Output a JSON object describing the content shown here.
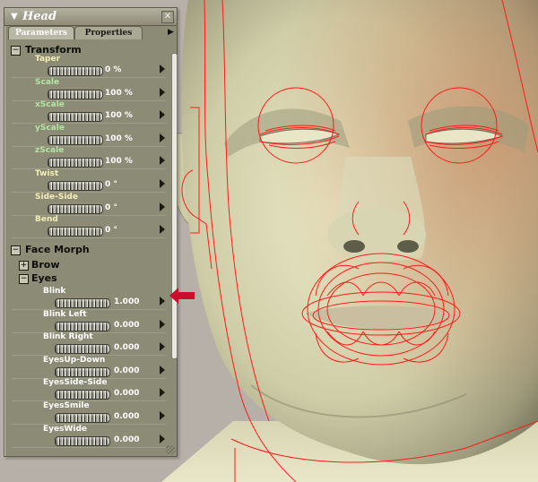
{
  "panel": {
    "title": "Head",
    "tabs": [
      {
        "label": "Parameters",
        "active": true
      },
      {
        "label": "Properties",
        "active": false
      }
    ],
    "groups": [
      {
        "label": "Transform",
        "expanded": true,
        "level": 0,
        "params": [
          {
            "label": "Taper",
            "value": "0 %",
            "color": "#f3efb4"
          },
          {
            "label": "Scale",
            "value": "100 %",
            "color": "#b3e6a3"
          },
          {
            "label": "xScale",
            "value": "100 %",
            "color": "#b3e6a3"
          },
          {
            "label": "yScale",
            "value": "100 %",
            "color": "#b3e6a3"
          },
          {
            "label": "zScale",
            "value": "100 %",
            "color": "#b3e6a3"
          },
          {
            "label": "Twist",
            "value": "0 °",
            "color": "#f3efb4"
          },
          {
            "label": "Side-Side",
            "value": "0 °",
            "color": "#f3efb4"
          },
          {
            "label": "Bend",
            "value": "0 °",
            "color": "#f3efb4"
          }
        ]
      },
      {
        "label": "Face Morph",
        "expanded": true,
        "level": 0,
        "params": []
      },
      {
        "label": "Brow",
        "expanded": false,
        "level": 1,
        "params": []
      },
      {
        "label": "Eyes",
        "expanded": true,
        "level": 1,
        "params": [
          {
            "label": "Blink",
            "value": "1.000",
            "color": "#ffffff"
          },
          {
            "label": "Blink Left",
            "value": "0.000",
            "color": "#ffffff"
          },
          {
            "label": "Blink Right",
            "value": "0.000",
            "color": "#ffffff"
          },
          {
            "label": "EyesUp-Down",
            "value": "0.000",
            "color": "#ffffff"
          },
          {
            "label": "EyesSide-Side",
            "value": "0.000",
            "color": "#ffffff"
          },
          {
            "label": "EyesSmile",
            "value": "0.000",
            "color": "#ffffff"
          },
          {
            "label": "EyesWide",
            "value": "0.000",
            "color": "#ffffff"
          }
        ]
      }
    ],
    "scroll_position": 0.0
  },
  "icons": {
    "collapse": "triangle-down-icon",
    "close": "close-icon",
    "menu": "triangle-right-icon",
    "expand": "plus-box-icon",
    "collapse_box": "minus-box-icon",
    "pointer": "red-arrow-icon"
  },
  "colors": {
    "panel_bg": "#8c8b76",
    "wireframe": "#ff1a1a",
    "callout": "#c8102e",
    "skin_light": "#e7e4c2",
    "skin_dark": "#6b6a55"
  }
}
